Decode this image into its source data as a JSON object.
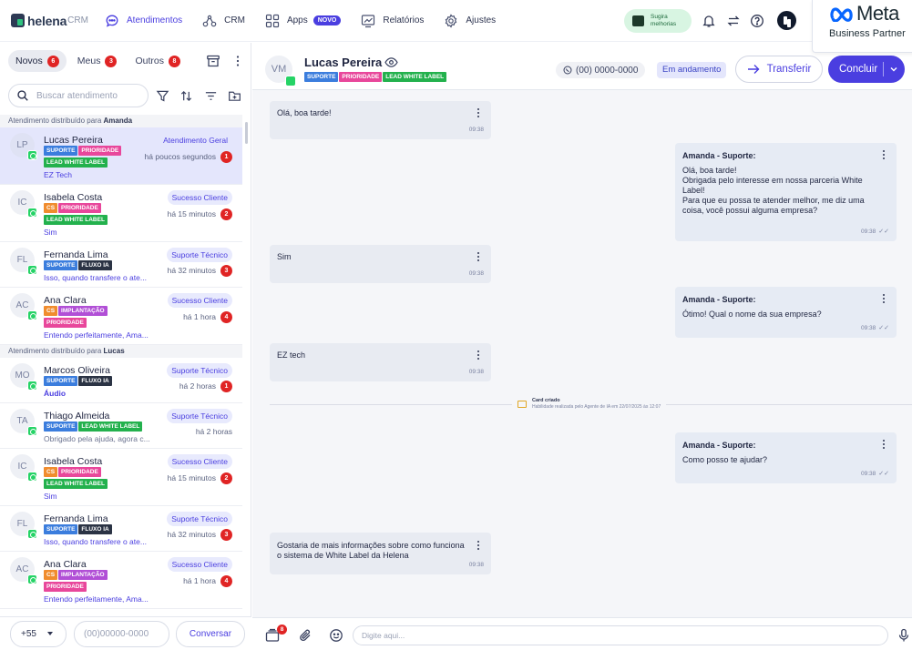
{
  "brand": {
    "name": "helena",
    "suffix": "CRM"
  },
  "nav": {
    "items": [
      {
        "label": "Atendimentos",
        "icon": "chat-bubble-icon",
        "active": true
      },
      {
        "label": "CRM",
        "icon": "crm-nodes-icon"
      },
      {
        "label": "Apps",
        "icon": "apps-grid-icon",
        "badge": "NOVO"
      },
      {
        "label": "Relatórios",
        "icon": "reports-chart-icon"
      },
      {
        "label": "Ajustes",
        "icon": "gear-icon"
      }
    ],
    "sugira": {
      "line1": "Sugira",
      "line2": "melhorias",
      "icon": "gift-icon"
    }
  },
  "meta_badge": {
    "brand": "Meta",
    "subtitle": "Business Partner"
  },
  "tabs": [
    {
      "label": "Novos",
      "count": "6",
      "active": true
    },
    {
      "label": "Meus",
      "count": "3"
    },
    {
      "label": "Outros",
      "count": "8"
    }
  ],
  "search": {
    "placeholder": "Buscar atendimento"
  },
  "groups": [
    {
      "title_prefix": "Atendimento distribuído para",
      "agent": "Amanda",
      "items": [
        {
          "initials": "LP",
          "name": "Lucas Pereira",
          "queue": "Atendimento Geral",
          "queue_style": "general",
          "time": "há poucos segundos",
          "unread": "1",
          "tags": [
            "SUPORTE",
            "PRIORIDADE",
            "LEAD WHITE LABEL"
          ],
          "subtitle": "EZ Tech",
          "selected": true
        },
        {
          "initials": "IC",
          "name": "Isabela Costa",
          "queue": "Sucesso Cliente",
          "queue_style": "sucesso",
          "time": "há 15 minutos",
          "unread": "2",
          "tags": [
            "CS",
            "PRIORIDADE",
            "LEAD WHITE LABEL"
          ],
          "subtitle": "Sim"
        },
        {
          "initials": "FL",
          "name": "Fernanda Lima",
          "queue": "Suporte Técnico",
          "queue_style": "suporte",
          "time": "há 32 minutos",
          "unread": "3",
          "tags": [
            "SUPORTE",
            "FLUXO IA"
          ],
          "subtitle": "Isso, quando transfere o ate..."
        },
        {
          "initials": "AC",
          "name": "Ana Clara",
          "queue": "Sucesso Cliente",
          "queue_style": "sucesso",
          "time": "há 1 hora",
          "unread": "4",
          "tags": [
            "CS",
            "IMPLANTAÇÃO",
            "PRIORIDADE"
          ],
          "subtitle": "Entendo perfeitamente, Ama..."
        }
      ]
    },
    {
      "title_prefix": "Atendimento distribuído para",
      "agent": "Lucas",
      "items": [
        {
          "initials": "MO",
          "name": "Marcos Oliveira",
          "queue": "Suporte Técnico",
          "queue_style": "suporte",
          "time": "há 2 horas",
          "unread": "1",
          "tags": [
            "SUPORTE",
            "FLUXO IA"
          ],
          "subtitle": "Áudio",
          "subtitle_bold": true
        },
        {
          "initials": "TA",
          "name": "Thiago Almeida",
          "queue": "Suporte Técnico",
          "queue_style": "suporte",
          "time": "há 2 horas",
          "unread": "",
          "tags": [
            "SUPORTE",
            "LEAD WHITE LABEL"
          ],
          "subtitle": "Obrigado pela ajuda, agora c...",
          "subtitle_muted": true
        },
        {
          "initials": "IC",
          "name": "Isabela Costa",
          "queue": "Sucesso Cliente",
          "queue_style": "sucesso",
          "time": "há 15 minutos",
          "unread": "2",
          "tags": [
            "CS",
            "PRIORIDADE",
            "LEAD WHITE LABEL"
          ],
          "subtitle": "Sim"
        },
        {
          "initials": "FL",
          "name": "Fernanda Lima",
          "queue": "Suporte Técnico",
          "queue_style": "suporte",
          "time": "há 32 minutos",
          "unread": "3",
          "tags": [
            "SUPORTE",
            "FLUXO IA"
          ],
          "subtitle": "Isso, quando transfere o ate..."
        },
        {
          "initials": "AC",
          "name": "Ana Clara",
          "queue": "Sucesso Cliente",
          "queue_style": "sucesso",
          "time": "há 1 hora",
          "unread": "4",
          "tags": [
            "CS",
            "IMPLANTAÇÃO",
            "PRIORIDADE"
          ],
          "subtitle": "Entendo perfeitamente, Ama..."
        }
      ]
    }
  ],
  "tag_colors": {
    "SUPORTE": "#3b7ddd",
    "PRIORIDADE": "#e8479b",
    "LEAD WHITE LABEL": "#23b14d",
    "CS": "#f08c2e",
    "FLUXO IA": "#2b3344",
    "IMPLANTAÇÃO": "#b14fd6"
  },
  "new_conversation": {
    "country_code": "+55",
    "phone_placeholder": "(00)00000-0000",
    "button": "Conversar"
  },
  "chat": {
    "contact": {
      "initials": "VM",
      "name": "Lucas Pereira",
      "tags": [
        "SUPORTE",
        "PRIORIDADE",
        "LEAD WHITE LABEL"
      ]
    },
    "phone": "(00) 0000-0000",
    "status": "Em andamento",
    "transfer_label": "Transferir",
    "conclude_label": "Concluir",
    "messages": [
      {
        "dir": "in",
        "body": "Olá, boa tarde!",
        "time": "09:38"
      },
      {
        "dir": "out",
        "author": "Amanda - Suporte:",
        "body": "Olá, boa tarde!\nObrigada pelo interesse em nossa parceria White Label!\nPara que eu possa te atender melhor, me diz uma coisa, você possui alguma empresa?",
        "time": "09:38"
      },
      {
        "dir": "in",
        "body": "Sim",
        "time": "09:38"
      },
      {
        "dir": "out",
        "author": "Amanda - Suporte:",
        "body": "Ótimo! Qual o nome da sua empresa?",
        "time": "09:38"
      },
      {
        "dir": "in",
        "body": "EZ tech",
        "time": "09:38"
      },
      {
        "dir": "out",
        "author": "Amanda - Suporte:",
        "body": "Como posso te ajudar?",
        "time": "09:38"
      },
      {
        "dir": "in",
        "body": "Gostaria de mais informações sobre como funciona o sistema de White Label da Helena",
        "time": "09:38"
      }
    ],
    "card_event": {
      "title": "Card criado",
      "subtitle": "Habilidade realizada pelo Agente de IA em 22/07/2025 às 12:07"
    },
    "composer": {
      "placeholder": "Digite aqui...",
      "attachments_badge": "8"
    }
  },
  "colors": {
    "accent": "#4a3ee0",
    "unread": "#e02424",
    "whatsapp": "#25d366",
    "meta": "#0866ff"
  }
}
